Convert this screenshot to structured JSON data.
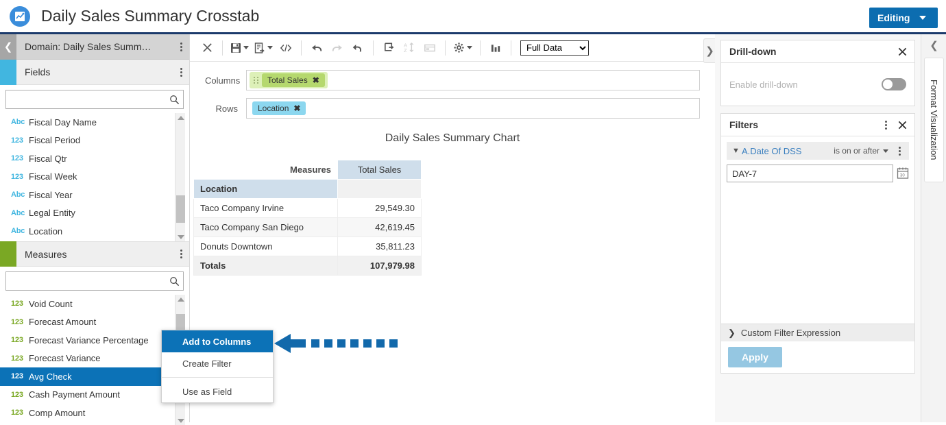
{
  "titlebar": {
    "app_icon": "chart-logo-icon",
    "title": "Daily Sales Summary Crosstab",
    "editing_label": "Editing"
  },
  "left_panel": {
    "domain_title": "Domain: Daily Sales Summ…",
    "fields": {
      "section_title": "Fields",
      "search_value": "",
      "search_placeholder": "",
      "items": [
        {
          "type": "Abc",
          "label": "Fiscal Day Name"
        },
        {
          "type": "123",
          "label": "Fiscal Period"
        },
        {
          "type": "123",
          "label": "Fiscal Qtr"
        },
        {
          "type": "123",
          "label": "Fiscal Week"
        },
        {
          "type": "Abc",
          "label": "Fiscal Year"
        },
        {
          "type": "Abc",
          "label": "Legal Entity"
        },
        {
          "type": "Abc",
          "label": "Location"
        }
      ]
    },
    "measures": {
      "section_title": "Measures",
      "search_value": "",
      "search_placeholder": "",
      "items": [
        {
          "type": "123",
          "label": "Void Count",
          "selected": false
        },
        {
          "type": "123",
          "label": "Forecast Amount",
          "selected": false
        },
        {
          "type": "123",
          "label": "Forecast Variance Percentage",
          "selected": false
        },
        {
          "type": "123",
          "label": "Forecast Variance",
          "selected": false
        },
        {
          "type": "123",
          "label": "Avg Check",
          "selected": true
        },
        {
          "type": "123",
          "label": "Cash Payment Amount",
          "selected": false
        },
        {
          "type": "123",
          "label": "Comp Amount",
          "selected": false
        }
      ]
    }
  },
  "toolbar": {
    "buttons": [
      {
        "name": "close-icon",
        "enabled": true
      },
      {
        "name": "save-icon",
        "enabled": true
      },
      {
        "name": "export-icon",
        "enabled": true
      },
      {
        "name": "code-icon",
        "enabled": true
      },
      {
        "name": "undo-icon",
        "enabled": true
      },
      {
        "name": "redo-icon",
        "enabled": false
      },
      {
        "name": "revert-icon",
        "enabled": true
      },
      {
        "name": "refresh-icon",
        "enabled": true
      },
      {
        "name": "sort-icon",
        "enabled": false
      },
      {
        "name": "page-icon",
        "enabled": false
      },
      {
        "name": "settings-icon",
        "enabled": true
      },
      {
        "name": "chart-type-icon",
        "enabled": true
      }
    ],
    "data_mode": "Full Data",
    "data_mode_options": [
      "Full Data"
    ]
  },
  "shelves": {
    "columns_label": "Columns",
    "columns_chips": [
      "Total Sales"
    ],
    "rows_label": "Rows",
    "rows_chips": [
      "Location"
    ]
  },
  "chart_data": {
    "type": "table",
    "title": "Daily Sales Summary Chart",
    "measures_header": "Measures",
    "column_headers": [
      "Total Sales"
    ],
    "row_dimension": "Location",
    "categories": [
      "Taco Company Irvine",
      "Taco Company San Diego",
      "Donuts Downtown"
    ],
    "values": [
      29549.3,
      42619.45,
      35811.23
    ],
    "value_labels": [
      "29,549.30",
      "42,619.45",
      "35,811.23"
    ],
    "total_label": "Totals",
    "total_value": 107979.98,
    "total_value_label": "107,979.98",
    "xlabel": "",
    "ylabel": ""
  },
  "context_menu": {
    "items": [
      {
        "label": "Add to Columns",
        "highlight": true
      },
      {
        "label": "Create Filter",
        "highlight": false
      },
      {
        "label": "Use as Field",
        "highlight": false
      }
    ]
  },
  "right_panel": {
    "drilldown": {
      "title": "Drill-down",
      "enable_label": "Enable drill-down",
      "enabled": false
    },
    "filters": {
      "title": "Filters",
      "field": "A.Date Of DSS",
      "operator": "is on or after",
      "value": "DAY-7",
      "custom_expression_label": "Custom Filter Expression",
      "apply_label": "Apply"
    }
  },
  "right_rail": {
    "tab_label": "Format Visualization"
  },
  "colors": {
    "accent_blue": "#0c6db0",
    "title_underline": "#1b3a6b",
    "selection_blue": "#0c72b7",
    "fields_accent": "#41b6e0",
    "measures_accent": "#7aa824",
    "chip_green": "#b5d86e",
    "chip_blue": "#8cd7ef",
    "table_header_blue": "#cfdeeb",
    "apply_button": "#95c7e2",
    "annotation_arrow": "#1269ab"
  }
}
